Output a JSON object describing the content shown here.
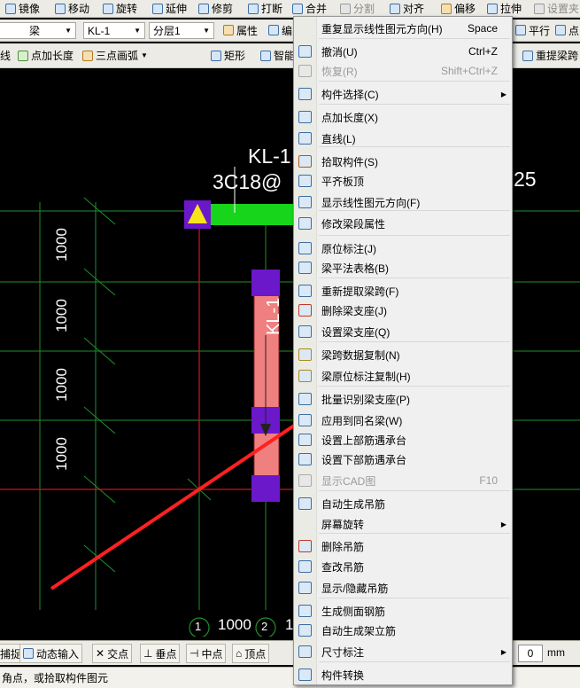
{
  "toolbar1": {
    "items": [
      {
        "label": "镜像",
        "icon": "mirror-icon"
      },
      {
        "label": "移动",
        "icon": "move-icon"
      },
      {
        "label": "旋转",
        "icon": "rotate-icon"
      },
      {
        "label": "延伸",
        "icon": "extend-icon"
      },
      {
        "label": "修剪",
        "icon": "trim-icon"
      },
      {
        "label": "打断",
        "icon": "break-icon"
      },
      {
        "label": "合并",
        "icon": "merge-icon"
      },
      {
        "label": "分割",
        "icon": "split-icon"
      },
      {
        "label": "对齐",
        "icon": "align-icon"
      },
      {
        "label": "偏移",
        "icon": "offset-icon"
      },
      {
        "label": "拉伸",
        "icon": "stretch-icon"
      },
      {
        "label": "设置夹",
        "icon": "set-grip-icon"
      }
    ]
  },
  "toolbar2": {
    "element_type": "梁",
    "element_name": "KL-1",
    "layer": "分层1",
    "properties_label": "属性",
    "edit_label": "编",
    "parallel_label": "平行",
    "point_label": "点"
  },
  "toolbar3": {
    "line_label": "线",
    "point_length_label": "点加长度",
    "arc_label": "三点画弧",
    "rect_label": "矩形",
    "smart_label": "智能",
    "relift_label": "重提梁跨"
  },
  "canvas": {
    "beam_name_top": "KL-1",
    "beam_spec_top": "3C18@",
    "beam_spec_suffix": "25",
    "beam_name_vertical": "KL-1",
    "dim_labels": [
      "1000",
      "1000",
      "1000",
      "1000"
    ],
    "axis_labels": [
      "1",
      "2"
    ],
    "bottom_dim": "1000",
    "bottom_dim_cut": "1",
    "colors": {
      "grid": "#1f8f2a",
      "red_line": "#d0141c",
      "beam": "#f07f80",
      "support": "#6a18c9",
      "green_beam": "#17d51a",
      "arrow": "#ff2020"
    }
  },
  "statusbar": {
    "items": [
      {
        "label": "捕捉"
      },
      {
        "label": "动态输入"
      },
      {
        "label": "交点"
      },
      {
        "label": "垂点"
      },
      {
        "label": "中点"
      },
      {
        "label": "顶点"
      }
    ],
    "angle_value": "0",
    "unit": "mm"
  },
  "hint": {
    "text": "角点，或拾取构件图元"
  },
  "context_menu": {
    "items": [
      {
        "label": "重复显示线性图元方向(H)",
        "shortcut": "Space",
        "icon": "",
        "disabled": false,
        "submenu": false
      },
      {
        "label": "撤消(U)",
        "shortcut": "Ctrl+Z",
        "icon": "undo-icon",
        "disabled": false,
        "submenu": false
      },
      {
        "label": "恢复(R)",
        "shortcut": "Shift+Ctrl+Z",
        "icon": "redo-icon",
        "disabled": true,
        "submenu": false
      },
      {
        "label": "构件选择(C)",
        "shortcut": "",
        "icon": "select-component-icon",
        "disabled": false,
        "submenu": true
      },
      {
        "label": "点加长度(X)",
        "shortcut": "",
        "icon": "point-length-icon",
        "disabled": false,
        "submenu": false
      },
      {
        "label": "直线(L)",
        "shortcut": "",
        "icon": "line-icon",
        "disabled": false,
        "submenu": false
      },
      {
        "label": "拾取构件(S)",
        "shortcut": "",
        "icon": "eyedropper-icon",
        "disabled": false,
        "submenu": false
      },
      {
        "label": "平齐板顶",
        "shortcut": "",
        "icon": "align-slab-top-icon",
        "disabled": false,
        "submenu": false
      },
      {
        "label": "显示线性图元方向(F)",
        "shortcut": "",
        "icon": "show-direction-icon",
        "disabled": false,
        "submenu": false
      },
      {
        "label": "修改梁段属性",
        "shortcut": "",
        "icon": "edit-beam-segment-icon",
        "disabled": false,
        "submenu": false
      },
      {
        "label": "原位标注(J)",
        "shortcut": "",
        "icon": "in-situ-annotation-icon",
        "disabled": false,
        "submenu": false
      },
      {
        "label": "梁平法表格(B)",
        "shortcut": "",
        "icon": "beam-table-icon",
        "disabled": false,
        "submenu": false
      },
      {
        "label": "重新提取梁跨(F)",
        "shortcut": "",
        "icon": "reextract-span-icon",
        "disabled": false,
        "submenu": false
      },
      {
        "label": "删除梁支座(J)",
        "shortcut": "",
        "icon": "delete-support-icon",
        "disabled": false,
        "submenu": false
      },
      {
        "label": "设置梁支座(Q)",
        "shortcut": "",
        "icon": "set-support-icon",
        "disabled": false,
        "submenu": false
      },
      {
        "label": "梁跨数据复制(N)",
        "shortcut": "",
        "icon": "copy-span-data-icon",
        "disabled": false,
        "submenu": false
      },
      {
        "label": "梁原位标注复制(H)",
        "shortcut": "",
        "icon": "copy-annotation-icon",
        "disabled": false,
        "submenu": false
      },
      {
        "label": "批量识别梁支座(P)",
        "shortcut": "",
        "icon": "batch-identify-support-icon",
        "disabled": false,
        "submenu": false
      },
      {
        "label": "应用到同名梁(W)",
        "shortcut": "",
        "icon": "apply-same-name-icon",
        "disabled": false,
        "submenu": false
      },
      {
        "label": "设置上部筋遇承台",
        "shortcut": "",
        "icon": "top-rebar-cap-icon",
        "disabled": false,
        "submenu": false
      },
      {
        "label": "设置下部筋遇承台",
        "shortcut": "",
        "icon": "bottom-rebar-cap-icon",
        "disabled": false,
        "submenu": false
      },
      {
        "label": "显示CAD图",
        "shortcut": "F10",
        "icon": "cad-icon",
        "disabled": true,
        "submenu": false
      },
      {
        "label": "自动生成吊筋",
        "shortcut": "",
        "icon": "auto-hanger-icon",
        "disabled": false,
        "submenu": false
      },
      {
        "label": "屏幕旋转",
        "shortcut": "",
        "icon": "",
        "disabled": false,
        "submenu": true
      },
      {
        "label": "删除吊筋",
        "shortcut": "",
        "icon": "delete-hanger-icon",
        "disabled": false,
        "submenu": false
      },
      {
        "label": "查改吊筋",
        "shortcut": "",
        "icon": "edit-hanger-icon",
        "disabled": false,
        "submenu": false
      },
      {
        "label": "显示/隐藏吊筋",
        "shortcut": "",
        "icon": "toggle-hanger-icon",
        "disabled": false,
        "submenu": false
      },
      {
        "label": "生成侧面钢筋",
        "shortcut": "",
        "icon": "side-rebar-icon",
        "disabled": false,
        "submenu": false
      },
      {
        "label": "自动生成架立筋",
        "shortcut": "",
        "icon": "auto-erection-rebar-icon",
        "disabled": false,
        "submenu": false
      },
      {
        "label": "尺寸标注",
        "shortcut": "",
        "icon": "dimension-icon",
        "disabled": false,
        "submenu": true
      },
      {
        "label": "构件转换",
        "shortcut": "",
        "icon": "convert-component-icon",
        "disabled": false,
        "submenu": false
      }
    ]
  }
}
